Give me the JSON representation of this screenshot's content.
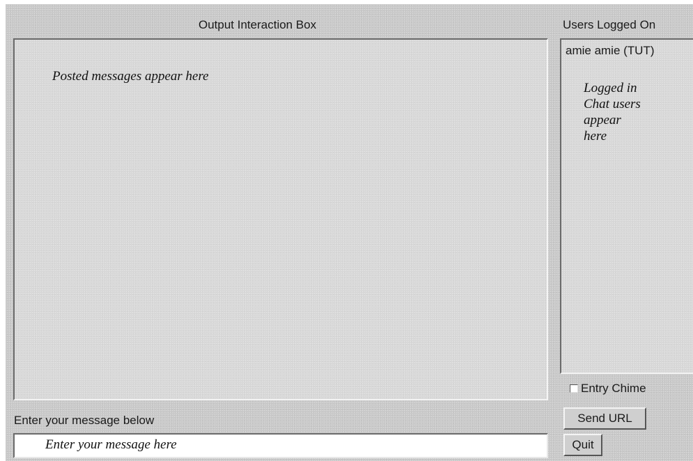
{
  "output": {
    "title": "Output Interaction Box",
    "placeholder_hint": "Posted messages appear here"
  },
  "users": {
    "title": "Users Logged On",
    "list": [
      "amie amie (TUT)"
    ],
    "placeholder_hint": "Logged in Chat users appear here"
  },
  "options": {
    "entry_chime_label": "Entry Chime",
    "entry_chime_checked": false
  },
  "input": {
    "label": "Enter your message below",
    "placeholder_hint": "Enter your message here",
    "value": ""
  },
  "buttons": {
    "send_url": "Send URL",
    "quit": "Quit"
  }
}
